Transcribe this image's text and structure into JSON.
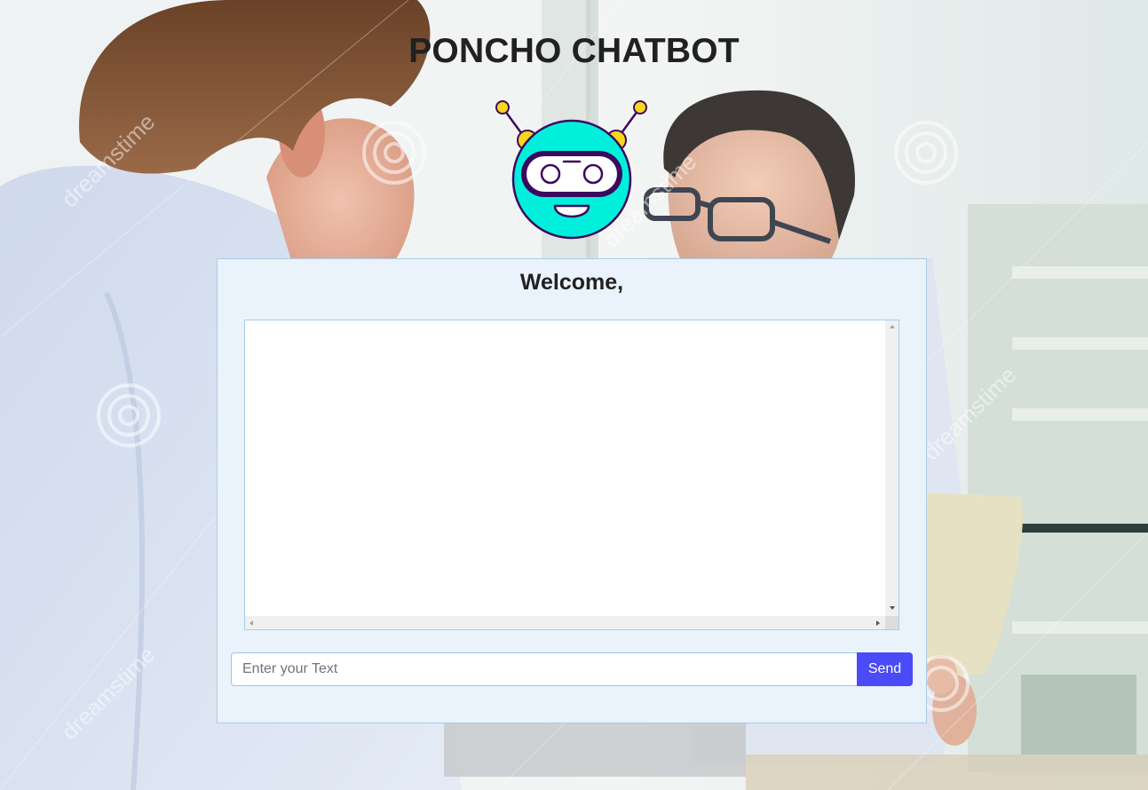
{
  "app": {
    "title": "PONCHO CHATBOT"
  },
  "chat": {
    "welcome": "Welcome,",
    "messages": []
  },
  "composer": {
    "placeholder": "Enter your Text",
    "value": "",
    "send_label": "Send"
  },
  "background": {
    "watermark": "dreamstime"
  },
  "icons": {
    "robot": "robot-icon"
  },
  "colors": {
    "robot_face": "#00f0dc",
    "robot_outline": "#3b0a5e",
    "robot_accent": "#f7d71c",
    "panel_bg": "#eaf2fb",
    "panel_border": "#a9cde8",
    "send_button": "#4a4af6",
    "title_text": "#212121"
  }
}
